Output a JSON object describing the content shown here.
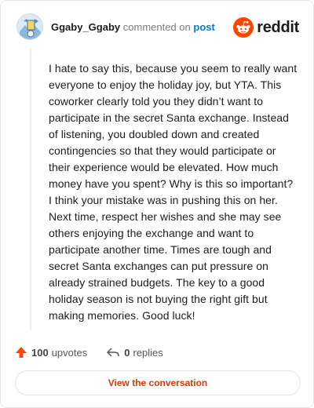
{
  "header": {
    "username": "Ggaby_Ggaby",
    "action_text": "commented on",
    "post_link": "post",
    "logo_text": "reddit"
  },
  "comment": {
    "body": "I hate to say this, because you seem to really want everyone to enjoy the holiday joy, but YTA. This coworker clearly told you they didn’t want to participate in the secret Santa exchange. Instead of listening, you doubled down and created contingencies so that they would participate or their experience would be elevated. How much money have you spent? Why is this so important? I think your mistake was in pushing this on her. Next time, respect her wishes and she may see others enjoying the exchange and want to participate another time. Times are tough and secret Santa exchanges can put pressure on already strained budgets. The key to a good holiday season is not buying the right gift but making memories. Good luck!"
  },
  "actions": {
    "upvotes_count": "100",
    "upvotes_label": "upvotes",
    "replies_count": "0",
    "replies_label": "replies"
  },
  "footer": {
    "button_label": "View the conversation"
  },
  "colors": {
    "brand": "#ff4500",
    "link": "#0079d3",
    "button_text": "#d93a00"
  }
}
